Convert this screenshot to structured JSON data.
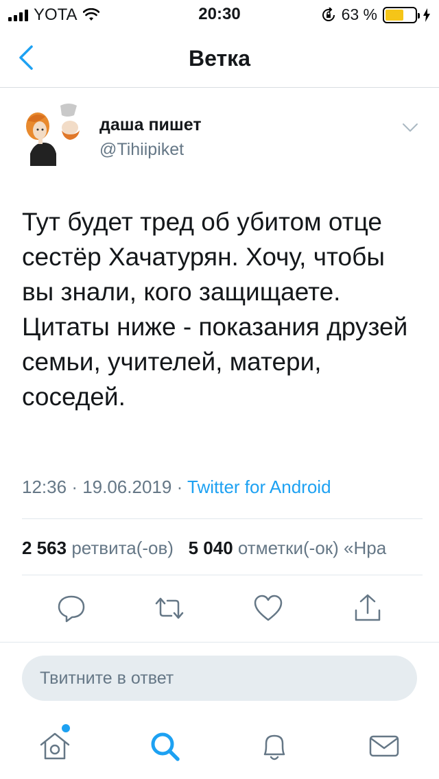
{
  "status_bar": {
    "carrier": "YOTA",
    "time": "20:30",
    "battery": "63 %",
    "battery_level": 0.63
  },
  "nav": {
    "title": "Ветка"
  },
  "tweet": {
    "author_name": "даша пишет",
    "author_handle": "@Tihiipiket",
    "text": "Тут будет тред об убитом отце сестёр Хачатурян. Хочу, чтобы вы знали, кого защищаете. Цитаты ниже - показания друзей семьи, учителей, матери, соседей.",
    "time": "12:36",
    "date": "19.06.2019",
    "source": "Twitter for Android",
    "retweets_count": "2 563",
    "retweets_label": "ретвита(-ов)",
    "likes_count": "5 040",
    "likes_label": "отметки(-ок) «Нра"
  },
  "reply": {
    "placeholder": "Твитните в ответ"
  },
  "colors": {
    "accent": "#1da1f2",
    "secondary_text": "#657786",
    "battery": "#f5c518"
  },
  "icons": [
    "chevron-left-icon",
    "chevron-down-icon",
    "reply-icon",
    "retweet-icon",
    "like-icon",
    "share-icon",
    "home-icon",
    "search-icon",
    "bell-icon",
    "mail-icon"
  ]
}
